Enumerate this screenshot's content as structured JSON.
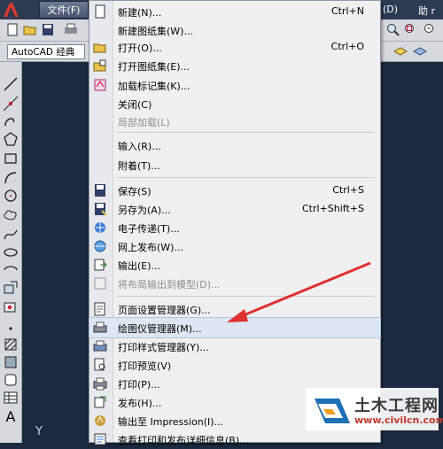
{
  "window": {
    "menu_file": "文件(F)",
    "menu_d": "(D)",
    "menu_help": "助 r"
  },
  "workspace": {
    "selected": "AutoCAD 经典"
  },
  "canvas": {
    "axis_label": "Y"
  },
  "file_menu": {
    "items": [
      {
        "label": "新建(N)...",
        "shortcut": "Ctrl+N",
        "icon": "new-file-icon"
      },
      {
        "label": "新建图纸集(W)...",
        "shortcut": "",
        "icon": ""
      },
      {
        "label": "打开(O)...",
        "shortcut": "Ctrl+O",
        "icon": "open-folder-icon"
      },
      {
        "label": "打开图纸集(E)...",
        "shortcut": "",
        "icon": "open-sheetset-icon"
      },
      {
        "label": "加载标记集(K)...",
        "shortcut": "",
        "icon": "markup-icon"
      },
      {
        "label": "关闭(C)",
        "shortcut": "",
        "icon": ""
      },
      {
        "label": "局部加载(L)",
        "shortcut": "",
        "icon": "",
        "disabled": true
      },
      {
        "label": "输入(R)...",
        "shortcut": "",
        "icon": ""
      },
      {
        "label": "附着(T)...",
        "shortcut": "",
        "icon": ""
      },
      {
        "label": "保存(S)",
        "shortcut": "Ctrl+S",
        "icon": "save-icon"
      },
      {
        "label": "另存为(A)...",
        "shortcut": "Ctrl+Shift+S",
        "icon": "save-as-icon"
      },
      {
        "label": "电子传递(T)...",
        "shortcut": "",
        "icon": "etransmit-icon"
      },
      {
        "label": "网上发布(W)...",
        "shortcut": "",
        "icon": "publish-web-icon"
      },
      {
        "label": "输出(E)...",
        "shortcut": "",
        "icon": "export-icon"
      },
      {
        "label": "将布局输出到模型(D)...",
        "shortcut": "",
        "icon": "layout-export-icon",
        "disabled": true
      },
      {
        "label": "页面设置管理器(G)...",
        "shortcut": "",
        "icon": "page-setup-icon"
      },
      {
        "label": "绘图仪管理器(M)...",
        "shortcut": "",
        "icon": "plotter-icon"
      },
      {
        "label": "打印样式管理器(Y)...",
        "shortcut": "",
        "icon": "plot-style-icon"
      },
      {
        "label": "打印预览(V)",
        "shortcut": "",
        "icon": "print-preview-icon"
      },
      {
        "label": "打印(P)...",
        "shortcut": "",
        "icon": "print-icon"
      },
      {
        "label": "发布(H)...",
        "shortcut": "",
        "icon": "publish-icon"
      },
      {
        "label": "输出至 Impression(I)...",
        "shortcut": "",
        "icon": "impression-icon"
      },
      {
        "label": "查看打印和发布详细信息(B)...",
        "shortcut": "",
        "icon": "details-icon"
      }
    ]
  },
  "watermark": {
    "title": "土木工程网",
    "url": "www.civilcn.com"
  },
  "colors": {
    "arrow": "#e03030",
    "canvas": "#1b2a40",
    "menu_bg": "#f0f0f0",
    "highlight": "#dde6f2"
  }
}
